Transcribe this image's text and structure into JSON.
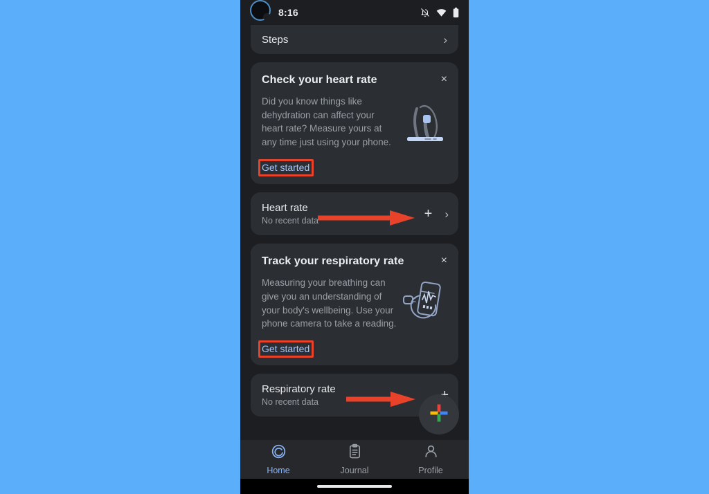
{
  "colors": {
    "page_background": "#5aaefa",
    "phone_background": "#1c1e21",
    "card_background": "#2b2e33",
    "accent_link": "#a8c7fa",
    "annotation_red": "#e8432a",
    "nav_active": "#8ab4f8",
    "fab_background": "#34373c",
    "google_red": "#ea4335",
    "google_yellow": "#fbbc05",
    "google_blue": "#4285f4",
    "google_green": "#34a853"
  },
  "statusbar": {
    "time": "8:16",
    "avatar_icon": "avatar-ring-icon",
    "icons": [
      "notifications-off-icon",
      "wifi-icon",
      "battery-icon"
    ]
  },
  "cards": {
    "steps": {
      "title": "Steps",
      "chevron": "›"
    },
    "heart_promo": {
      "title": "Check your heart rate",
      "close_label": "×",
      "body": "Did you know things like dehydration can affect your heart rate? Measure yours at any time just using your phone.",
      "cta_label": "Get started",
      "illustration": "finger-on-phone-illustration",
      "cta_annotated": true
    },
    "heart_metric": {
      "title": "Heart rate",
      "subtitle": "No recent data",
      "plus_label": "+",
      "chevron": "›",
      "arrow_annotation": "points-to-plus"
    },
    "respiratory_promo": {
      "title": "Track your respiratory rate",
      "close_label": "×",
      "body": "Measuring your breathing can give you an understanding of your body's wellbeing. Use your phone camera to take a reading.",
      "cta_label": "Get started",
      "illustration": "phone-stethoscope-illustration",
      "cta_annotated": true
    },
    "respiratory_metric": {
      "title": "Respiratory rate",
      "subtitle": "No recent data",
      "plus_label": "+",
      "arrow_annotation": "points-to-plus"
    }
  },
  "fab": {
    "icon": "google-plus-icon",
    "label": "Add data"
  },
  "bottom_nav": {
    "items": [
      {
        "label": "Home",
        "icon": "home-rings-icon",
        "active": true
      },
      {
        "label": "Journal",
        "icon": "journal-clipboard-icon",
        "active": false
      },
      {
        "label": "Profile",
        "icon": "profile-person-icon",
        "active": false
      }
    ]
  }
}
